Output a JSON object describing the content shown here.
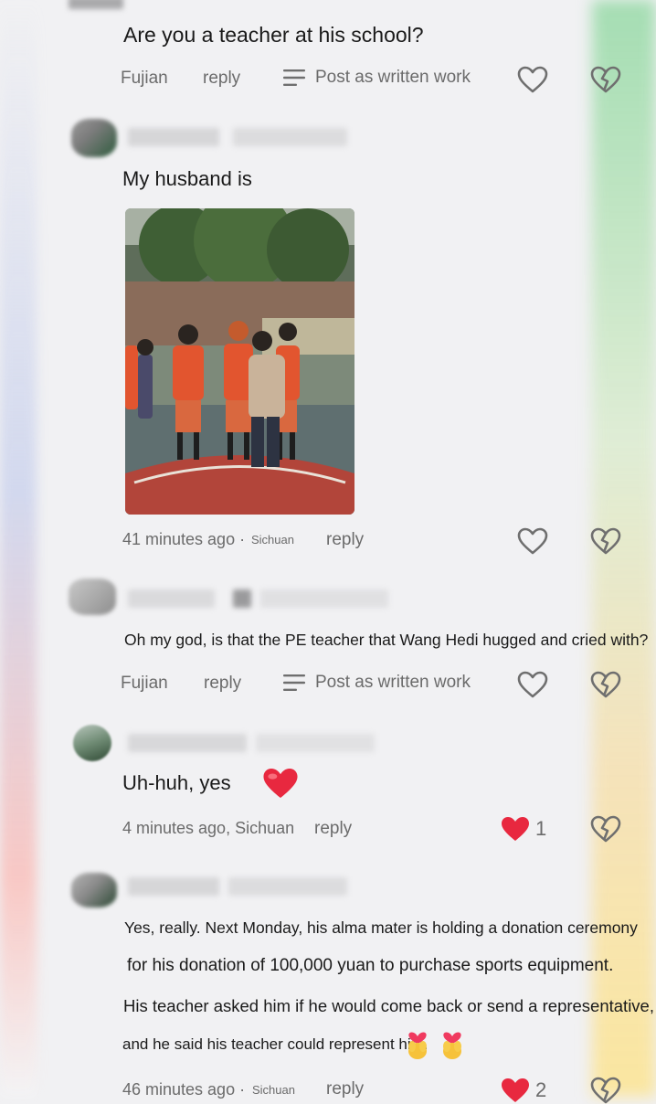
{
  "comments": [
    {
      "text": "Are you a teacher at his school?",
      "location": "Fujian",
      "reply": "reply",
      "post_as": "Post as written work"
    },
    {
      "text": "My husband is",
      "time": "41 minutes ago ·",
      "location": "Sichuan",
      "reply": "reply"
    },
    {
      "text": "Oh my god, is that the PE teacher that Wang Hedi hugged and cried with?",
      "location": "Fujian",
      "reply": "reply",
      "post_as": "Post as written work"
    },
    {
      "text": "Uh-huh, yes",
      "time": "4 minutes ago, Sichuan",
      "reply": "reply",
      "likes": "1"
    },
    {
      "lines": [
        "Yes, really. Next Monday, his alma mater is holding a donation ceremony",
        "for his donation of 100,000 yuan to purchase sports equipment.",
        "His teacher asked him if he would come back or send a representative,",
        "and he said his teacher could represent him."
      ],
      "time": "46 minutes ago ·",
      "location": "Sichuan",
      "reply": "reply",
      "likes": "2"
    }
  ],
  "colors": {
    "liked_heart": "#e8283f",
    "meta_text": "#6b6b6b",
    "icon_gray": "#6f6f6f"
  },
  "icons": [
    "heart-outline-icon",
    "broken-heart-icon",
    "menu-lines-icon",
    "heart-filled-icon",
    "red-heart-emoji",
    "heart-hands-emoji"
  ]
}
